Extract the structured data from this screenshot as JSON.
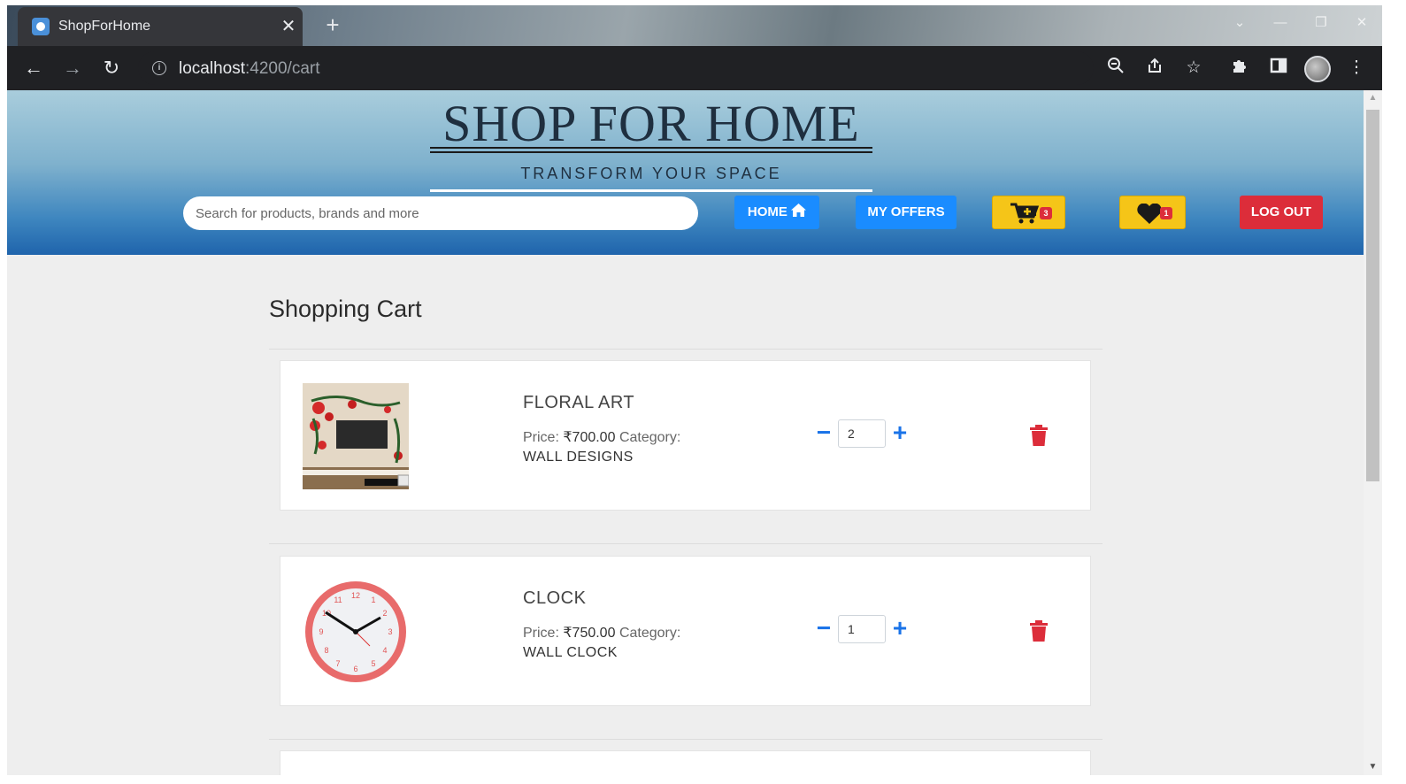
{
  "browser": {
    "tab_title": "ShopForHome",
    "tab_close": "✕",
    "new_tab": "+",
    "url_host": "localhost",
    "url_path": ":4200/cart"
  },
  "header": {
    "brand": "SHOP FOR HOME",
    "tagline": "TRANSFORM YOUR SPACE",
    "search_placeholder": "Search for products, brands and more",
    "home_label": "HOME",
    "offers_label": "MY OFFERS",
    "logout_label": "LOG OUT",
    "cart_count": "3",
    "wishlist_count": "1"
  },
  "cart": {
    "title": "Shopping Cart",
    "items": [
      {
        "name": "FLORAL ART",
        "price_label": "Price:",
        "price": "₹700.00",
        "category_label": "Category:",
        "category": "WALL DESIGNS",
        "quantity": "2",
        "image": "floral-art-image"
      },
      {
        "name": "CLOCK",
        "price_label": "Price:",
        "price": "₹750.00",
        "category_label": "Category:",
        "category": "WALL CLOCK",
        "quantity": "1",
        "image": "clock-image"
      }
    ]
  },
  "colors": {
    "primary_button": "#1a8cff",
    "danger": "#dc2d3a",
    "warning": "#f5c518",
    "qty_control": "#1a73e8"
  }
}
